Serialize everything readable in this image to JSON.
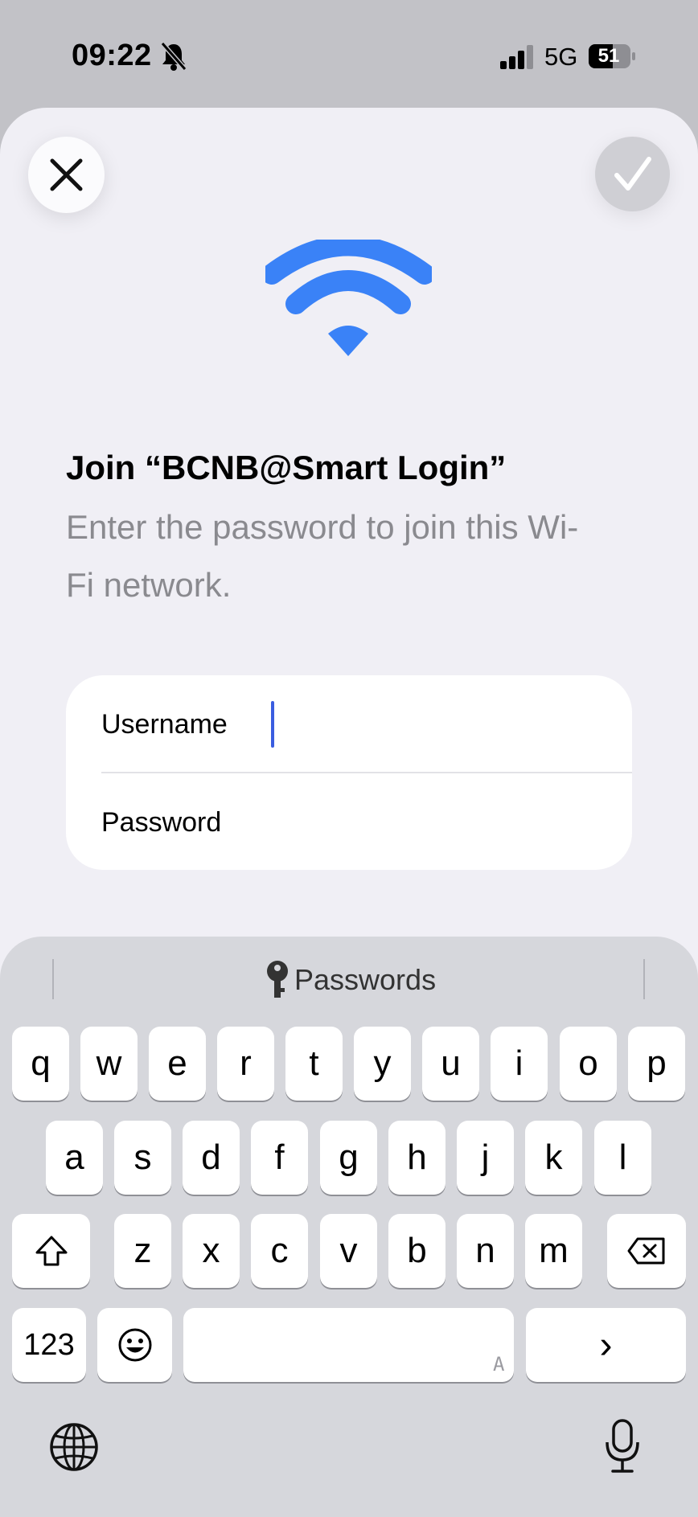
{
  "status_bar": {
    "time": "09:22",
    "network": "5G",
    "battery": "51"
  },
  "dialog": {
    "title": "Join “BCNB@Smart Login”",
    "subtitle": "Enter the password to join this Wi-Fi network."
  },
  "form": {
    "username_label": "Username",
    "username_value": "",
    "password_label": "Password",
    "password_value": ""
  },
  "keyboard": {
    "passwords_label": "Passwords",
    "row1": [
      "q",
      "w",
      "e",
      "r",
      "t",
      "y",
      "u",
      "i",
      "o",
      "p"
    ],
    "row2": [
      "a",
      "s",
      "d",
      "f",
      "g",
      "h",
      "j",
      "k",
      "l"
    ],
    "row3": [
      "z",
      "x",
      "c",
      "v",
      "b",
      "n",
      "m"
    ],
    "numbers_key": "123",
    "space_hint": "A",
    "return_glyph": "›"
  },
  "colors": {
    "accent": "#3a82f7",
    "caret": "#3a5de0",
    "secondary_text": "#8a8a8f"
  },
  "icons": [
    "bell-slash-icon",
    "signal-icon",
    "battery-icon",
    "close-icon",
    "checkmark-icon",
    "wifi-icon",
    "key-icon",
    "shift-icon",
    "delete-icon",
    "emoji-icon",
    "globe-icon",
    "microphone-icon"
  ]
}
